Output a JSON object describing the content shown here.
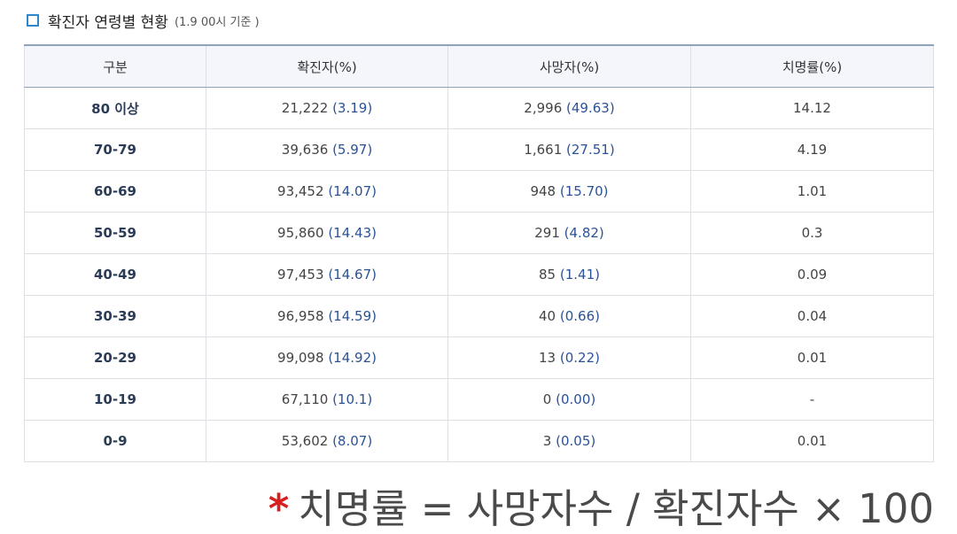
{
  "heading": {
    "title": "확진자 연령별 현황",
    "subtitle": "(1.9 00시 기준 )"
  },
  "table": {
    "headers": [
      "구분",
      "확진자(%)",
      "사망자(%)",
      "치명률(%)"
    ],
    "rows": [
      {
        "age": "80 이상",
        "cases": "21,222",
        "cases_pct": "(3.19)",
        "deaths": "2,996",
        "deaths_pct": "(49.63)",
        "cfr": "14.12"
      },
      {
        "age": "70-79",
        "cases": "39,636",
        "cases_pct": "(5.97)",
        "deaths": "1,661",
        "deaths_pct": "(27.51)",
        "cfr": "4.19"
      },
      {
        "age": "60-69",
        "cases": "93,452",
        "cases_pct": "(14.07)",
        "deaths": "948",
        "deaths_pct": "(15.70)",
        "cfr": "1.01"
      },
      {
        "age": "50-59",
        "cases": "95,860",
        "cases_pct": "(14.43)",
        "deaths": "291",
        "deaths_pct": "(4.82)",
        "cfr": "0.3"
      },
      {
        "age": "40-49",
        "cases": "97,453",
        "cases_pct": "(14.67)",
        "deaths": "85",
        "deaths_pct": "(1.41)",
        "cfr": "0.09"
      },
      {
        "age": "30-39",
        "cases": "96,958",
        "cases_pct": "(14.59)",
        "deaths": "40",
        "deaths_pct": "(0.66)",
        "cfr": "0.04"
      },
      {
        "age": "20-29",
        "cases": "99,098",
        "cases_pct": "(14.92)",
        "deaths": "13",
        "deaths_pct": "(0.22)",
        "cfr": "0.01"
      },
      {
        "age": "10-19",
        "cases": "67,110",
        "cases_pct": "(10.1)",
        "deaths": "0",
        "deaths_pct": "(0.00)",
        "cfr": "-"
      },
      {
        "age": "0-9",
        "cases": "53,602",
        "cases_pct": "(8.07)",
        "deaths": "3",
        "deaths_pct": "(0.05)",
        "cfr": "0.01"
      }
    ]
  },
  "footnote": {
    "star": "*",
    "text": "치명률 = 사망자수 / 확진자수 × 100"
  },
  "colors": {
    "accent": "#2f86c8",
    "value_blue": "#2c5296",
    "header_bg": "#f4f6fb",
    "footnote_star": "#d61f1f"
  }
}
